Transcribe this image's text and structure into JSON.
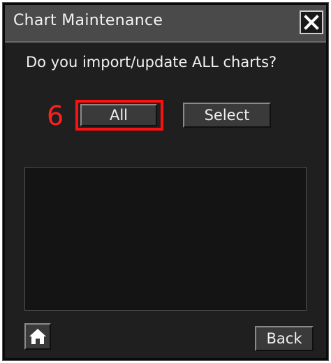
{
  "dialog": {
    "title": "Chart Maintenance",
    "close_icon": "close-x-icon",
    "prompt": "Do you import/update ALL charts?"
  },
  "annotation": {
    "step_number": "6",
    "highlight_color": "#ff1010"
  },
  "buttons": {
    "all_label": "All",
    "select_label": "Select",
    "back_label": "Back",
    "home_icon": "home-icon"
  },
  "colors": {
    "background": "#1f1f1f",
    "titlebar": "#4a4a4a",
    "text": "#f2f2f2",
    "step_number": "#ff2020"
  }
}
